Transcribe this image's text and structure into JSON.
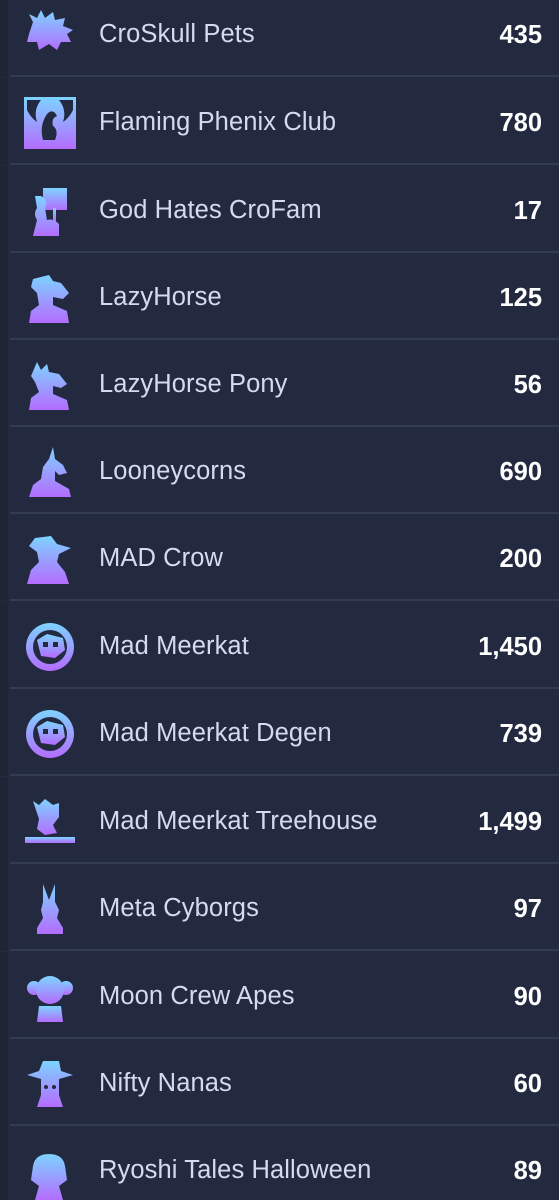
{
  "collections": [
    {
      "name": "CroSkull Pets",
      "count": "435",
      "icon": "croskull-pets-icon"
    },
    {
      "name": "Flaming Phenix Club",
      "count": "780",
      "icon": "phoenix-icon"
    },
    {
      "name": "God Hates CroFam",
      "count": "17",
      "icon": "protest-sign-icon"
    },
    {
      "name": "LazyHorse",
      "count": "125",
      "icon": "horse-icon"
    },
    {
      "name": "LazyHorse Pony",
      "count": "56",
      "icon": "pony-icon"
    },
    {
      "name": "Looneycorns",
      "count": "690",
      "icon": "unicorn-icon"
    },
    {
      "name": "MAD Crow",
      "count": "200",
      "icon": "crow-icon"
    },
    {
      "name": "Mad Meerkat",
      "count": "1,450",
      "icon": "meerkat-badge-icon"
    },
    {
      "name": "Mad Meerkat Degen",
      "count": "739",
      "icon": "meerkat-badge-icon"
    },
    {
      "name": "Mad Meerkat Treehouse",
      "count": "1,499",
      "icon": "treehouse-meerkat-icon"
    },
    {
      "name": "Meta Cyborgs",
      "count": "97",
      "icon": "rabbit-icon"
    },
    {
      "name": "Moon Crew Apes",
      "count": "90",
      "icon": "ape-icon"
    },
    {
      "name": "Nifty Nanas",
      "count": "60",
      "icon": "banana-hat-icon"
    },
    {
      "name": "Ryoshi Tales Halloween",
      "count": "89",
      "icon": "ryoshi-icon"
    }
  ],
  "colors": {
    "background": "#232a40",
    "divider": "#333b53",
    "icon_gradient_top": "#7dd3ff",
    "icon_gradient_bottom": "#b46cff",
    "name_text": "#d6d9f2",
    "count_text": "#ffffff"
  }
}
